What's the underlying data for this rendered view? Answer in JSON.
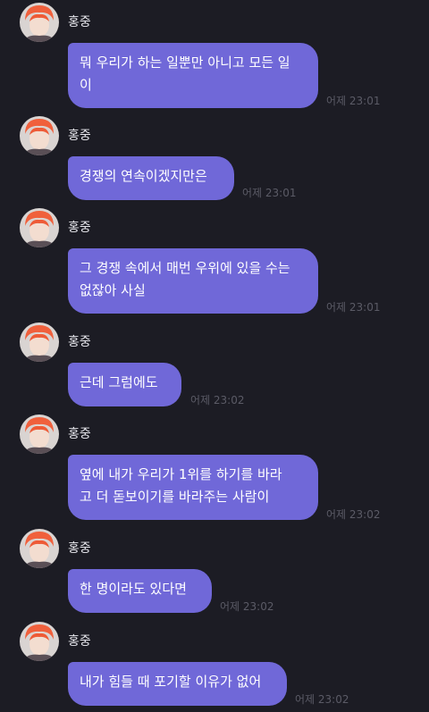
{
  "sender_name": "홍중",
  "messages": [
    {
      "text": "뭐 우리가 하는 일뿐만 아니고 모든 일\n이",
      "time": "어제 23:01"
    },
    {
      "text": "경쟁의 연속이겠지만은",
      "time": "어제 23:01"
    },
    {
      "text": "그 경쟁 속에서 매번 우위에 있을 수는\n없잖아 사실",
      "time": "어제 23:01"
    },
    {
      "text": "근데 그럼에도",
      "time": "어제 23:02"
    },
    {
      "text": "옆에 내가 우리가 1위를 하기를 바라\n고 더 돋보이기를 바라주는 사람이",
      "time": "어제 23:02"
    },
    {
      "text": "한 명이라도 있다면",
      "time": "어제 23:02"
    },
    {
      "text": "내가 힘들 때 포기할 이유가 없어",
      "time": "어제 23:02"
    }
  ]
}
